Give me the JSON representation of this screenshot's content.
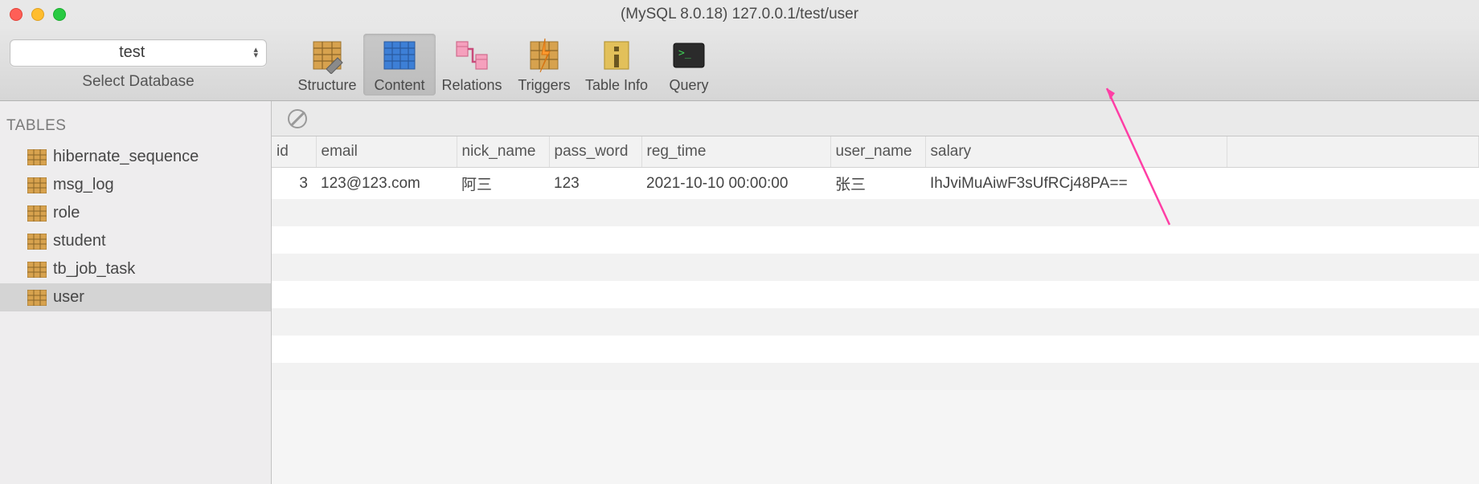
{
  "window": {
    "title": "(MySQL 8.0.18) 127.0.0.1/test/user"
  },
  "dbSelector": {
    "value": "test",
    "caption": "Select Database"
  },
  "tools": [
    {
      "key": "structure",
      "label": "Structure"
    },
    {
      "key": "content",
      "label": "Content"
    },
    {
      "key": "relations",
      "label": "Relations"
    },
    {
      "key": "triggers",
      "label": "Triggers"
    },
    {
      "key": "tableinfo",
      "label": "Table Info"
    },
    {
      "key": "query",
      "label": "Query"
    }
  ],
  "activeTool": "content",
  "sidebar": {
    "header": "TABLES",
    "items": [
      {
        "name": "hibernate_sequence"
      },
      {
        "name": "msg_log"
      },
      {
        "name": "role"
      },
      {
        "name": "student"
      },
      {
        "name": "tb_job_task"
      },
      {
        "name": "user"
      }
    ],
    "selected": "user"
  },
  "grid": {
    "columns": [
      "id",
      "email",
      "nick_name",
      "pass_word",
      "reg_time",
      "user_name",
      "salary"
    ],
    "rows": [
      {
        "id": "3",
        "email": "123@123.com",
        "nick_name": "阿三",
        "pass_word": "123",
        "reg_time": "2021-10-10 00:00:00",
        "user_name": "张三",
        "salary": "IhJviMuAiwF3sUfRCj48PA=="
      }
    ]
  },
  "colors": {
    "toolbarActive": "#c8c8c8",
    "rowAlt": "#f2f2f2",
    "annotationArrow": "#ff3ea5"
  }
}
